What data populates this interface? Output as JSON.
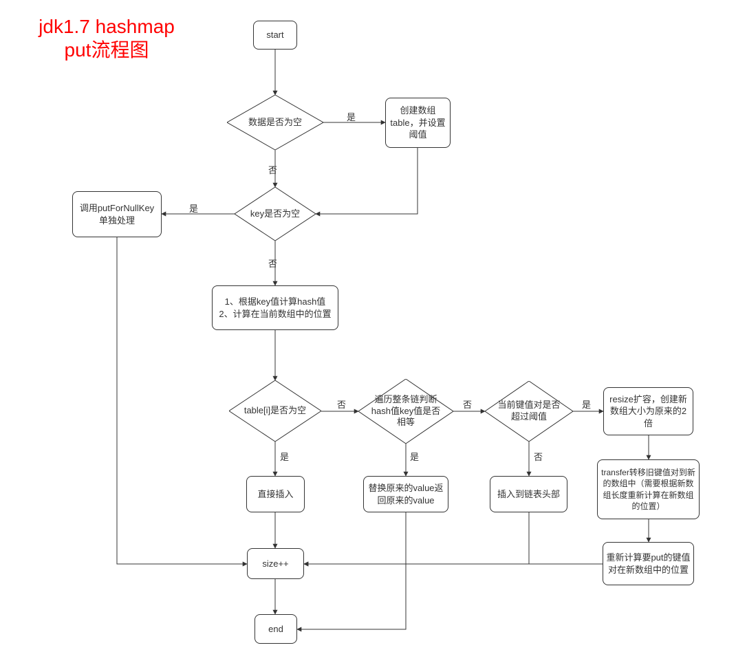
{
  "title_line1": "jdk1.7 hashmap",
  "title_line2": "put流程图",
  "nodes": {
    "start": "start",
    "d_data_empty": "数据是否为空",
    "create_table": "创建数组table，并设置阈值",
    "d_key_null": "key是否为空",
    "put_for_null": "调用putForNullKey单独处理",
    "calc_hash": "1、根据key值计算hash值\n2、计算在当前数组中的位置",
    "d_table_i": "table[i]是否为空",
    "direct_insert": "直接插入",
    "d_traverse": "遍历整条链判断hash值key值是否相等",
    "replace_val": "替换原来的value返回原来的value",
    "d_threshold": "当前键值对是否超过阈值",
    "insert_head": "插入到链表头部",
    "resize": "resize扩容，创建新数组大小为原来的2倍",
    "transfer": "transfer转移旧键值对到新的数组中（需要根据新数组长度重新计算在新数组的位置）",
    "recalc": "重新计算要put的键值对在新数组中的位置",
    "sizepp": "size++",
    "end": "end"
  },
  "labels": {
    "yes": "是",
    "no": "否"
  },
  "chart_data": {
    "type": "flowchart",
    "title": "jdk1.7 hashmap put流程图",
    "nodes": [
      {
        "id": "start",
        "kind": "terminator",
        "text": "start"
      },
      {
        "id": "d_data_empty",
        "kind": "decision",
        "text": "数据是否为空"
      },
      {
        "id": "create_table",
        "kind": "process",
        "text": "创建数组table，并设置阈值"
      },
      {
        "id": "d_key_null",
        "kind": "decision",
        "text": "key是否为空"
      },
      {
        "id": "put_for_null",
        "kind": "process",
        "text": "调用putForNullKey单独处理"
      },
      {
        "id": "calc_hash",
        "kind": "process",
        "text": "1、根据key值计算hash值  2、计算在当前数组中的位置"
      },
      {
        "id": "d_table_i",
        "kind": "decision",
        "text": "table[i]是否为空"
      },
      {
        "id": "direct_insert",
        "kind": "process",
        "text": "直接插入"
      },
      {
        "id": "d_traverse",
        "kind": "decision",
        "text": "遍历整条链判断hash值key值是否相等"
      },
      {
        "id": "replace_val",
        "kind": "process",
        "text": "替换原来的value 返回原来的value"
      },
      {
        "id": "d_threshold",
        "kind": "decision",
        "text": "当前键值对是否超过阈值"
      },
      {
        "id": "insert_head",
        "kind": "process",
        "text": "插入到链表头部"
      },
      {
        "id": "resize",
        "kind": "process",
        "text": "resize扩容，创建新数组大小为原来的2倍"
      },
      {
        "id": "transfer",
        "kind": "process",
        "text": "transfer转移旧键值对到新的数组中（需要根据新数组长度重新计算在新数组的位置）"
      },
      {
        "id": "recalc",
        "kind": "process",
        "text": "重新计算要put的键值对在新数组中的位置"
      },
      {
        "id": "sizepp",
        "kind": "process",
        "text": "size++"
      },
      {
        "id": "end",
        "kind": "terminator",
        "text": "end"
      }
    ],
    "edges": [
      {
        "from": "start",
        "to": "d_data_empty"
      },
      {
        "from": "d_data_empty",
        "to": "create_table",
        "label": "是"
      },
      {
        "from": "d_data_empty",
        "to": "d_key_null",
        "label": "否"
      },
      {
        "from": "create_table",
        "to": "d_key_null"
      },
      {
        "from": "d_key_null",
        "to": "put_for_null",
        "label": "是"
      },
      {
        "from": "d_key_null",
        "to": "calc_hash",
        "label": "否"
      },
      {
        "from": "put_for_null",
        "to": "sizepp"
      },
      {
        "from": "calc_hash",
        "to": "d_table_i"
      },
      {
        "from": "d_table_i",
        "to": "direct_insert",
        "label": "是"
      },
      {
        "from": "d_table_i",
        "to": "d_traverse",
        "label": "否"
      },
      {
        "from": "direct_insert",
        "to": "sizepp"
      },
      {
        "from": "d_traverse",
        "to": "replace_val",
        "label": "是"
      },
      {
        "from": "d_traverse",
        "to": "d_threshold",
        "label": "否"
      },
      {
        "from": "replace_val",
        "to": "end"
      },
      {
        "from": "d_threshold",
        "to": "insert_head",
        "label": "否"
      },
      {
        "from": "d_threshold",
        "to": "resize",
        "label": "是"
      },
      {
        "from": "insert_head",
        "to": "sizepp"
      },
      {
        "from": "resize",
        "to": "transfer"
      },
      {
        "from": "transfer",
        "to": "recalc"
      },
      {
        "from": "recalc",
        "to": "sizepp"
      },
      {
        "from": "sizepp",
        "to": "end"
      }
    ]
  }
}
